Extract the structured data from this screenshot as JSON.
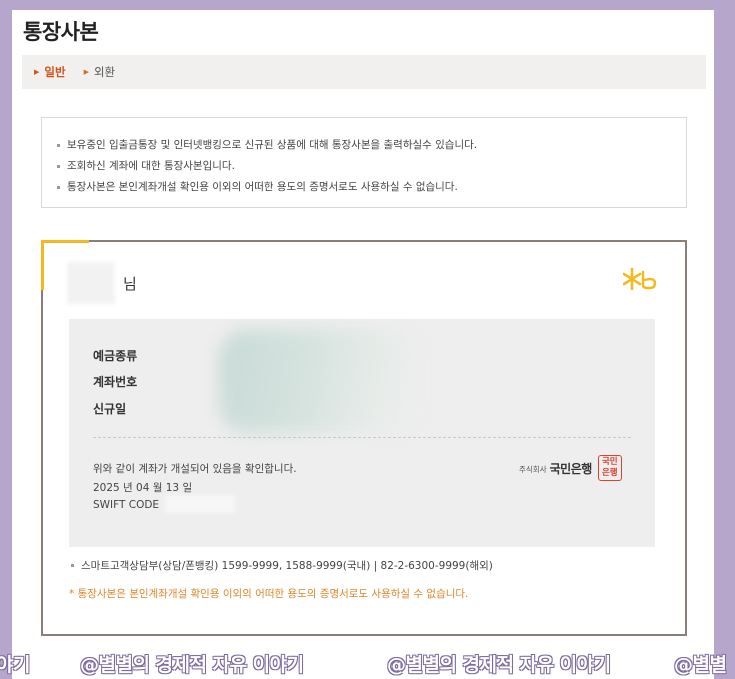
{
  "page": {
    "title": "통장사본"
  },
  "tabs": [
    {
      "label": "일반",
      "active": true
    },
    {
      "label": "외환",
      "active": false
    }
  ],
  "notice": {
    "items": [
      "보유중인 입출금통장 및 인터넷뱅킹으로 신규된 상품에 대해 통장사본을 출력하실수 있습니다.",
      "조회하신 계좌에 대한 통장사본입니다.",
      "통장사본은 본인계좌개설 확인용 이외의 어떠한 용도의 증명서로도 사용하실 수 없습니다."
    ]
  },
  "certificate": {
    "name_suffix": "님",
    "fields": {
      "deposit_type": "예금종류",
      "account_number": "계좌번호",
      "opened_date": "신규일"
    },
    "confirm_text": "위와 같이 계좌가 개설되어 있음을 확인합니다.",
    "issue_date": "2025 년 04 월 13 일",
    "swift_label": "SWIFT CODE",
    "bank": {
      "corp_prefix": "주식회사",
      "name": "국민은행",
      "seal_line1": "국민",
      "seal_line2": "은행"
    },
    "contact": "스마트고객상담부(상담/폰뱅킹) 1599-9999, 1588-9999(국내) | 82-2-6300-9999(해외)",
    "warning": "* 통장사본은 본인계좌개설 확인용 이외의 어떠한 용도의 증명서로도 사용하실 수 없습니다."
  },
  "watermark": {
    "segments": [
      "야기",
      "@별별의 경제적 자유 이야기",
      "@별별의 경제적 자유 이야기",
      "@별별"
    ]
  },
  "colors": {
    "accent": "#d4521d",
    "gold": "#f3b91f",
    "warning": "#e0862b",
    "seal": "#d8422e"
  }
}
